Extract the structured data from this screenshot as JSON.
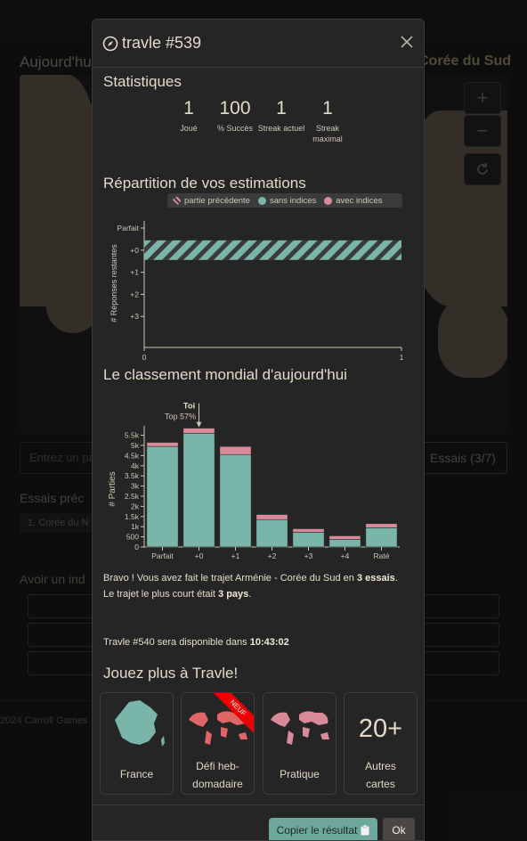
{
  "background": {
    "today_label": "Aujourd'hui",
    "target_country": "Corée du Sud",
    "zoom_in": "+",
    "zoom_out": "−",
    "input_placeholder": "Entrez un pay",
    "guess_button": "Essais (3/7)",
    "essais_title": "Essais préc",
    "essai_item": "1.  Corée du N",
    "hint_title": "Avoir un ind",
    "footer": "2024 Carroll Games"
  },
  "modal": {
    "title": "travle #539",
    "stats_title": "Statistiques",
    "stats": [
      {
        "value": "1",
        "label": "Joué"
      },
      {
        "value": "100",
        "label": "% Succès"
      },
      {
        "value": "1",
        "label": "Streak actuel"
      },
      {
        "value": "1",
        "label": "Streak maximal"
      }
    ],
    "distribution_title": "Répartition de vos estimations",
    "legend": {
      "previous": "partie précédente",
      "no_hints": "sans indices",
      "with_hints": "avec indices"
    },
    "ranking_title": "Le classement mondial d'aujourd'hui",
    "result": {
      "line1_pre": "Bravo ! Vous avez fait le trajet Arménie - Corée du Sud en ",
      "line1_bold": "3 essais",
      "line1_post": ".",
      "line2_pre": "Le trajet le plus court était ",
      "line2_bold": "3 pays",
      "line2_post": ".",
      "next_pre": "Travle #540 sera disponible dans ",
      "next_bold": "10:43:02"
    },
    "play_more_title": "Jouez plus à Travle!",
    "cards": [
      {
        "label": "France"
      },
      {
        "label": "Défi heb-\ndomadaire",
        "ribbon": "NEUF"
      },
      {
        "label": "Pratique"
      },
      {
        "label": "Autres\ncartes",
        "number": "20+"
      }
    ],
    "copy_button": "Copier le résultat",
    "ok_button": "Ok"
  },
  "colors": {
    "teal": "#79b5a9",
    "pink": "#d98a9a",
    "hatch_dark": "#3b3b3b"
  },
  "chart_data": [
    {
      "type": "bar",
      "orientation": "horizontal",
      "categories": [
        "Parfait",
        "+0",
        "+1",
        "+2",
        "+3"
      ],
      "series": [
        {
          "name": "partie précédente",
          "values": [
            0,
            1,
            0,
            0,
            0
          ]
        }
      ],
      "xlabel": "# Parties",
      "ylabel": "# Réponses restantes",
      "xlim": [
        0,
        1
      ],
      "xticks": [
        "0",
        "1"
      ],
      "grid": false
    },
    {
      "type": "bar",
      "stacked": true,
      "categories": [
        "Parfait",
        "+0",
        "+1",
        "+2",
        "+3",
        "+4",
        "Raté"
      ],
      "series": [
        {
          "name": "sans indices",
          "values": [
            4950,
            5600,
            4550,
            1350,
            730,
            380,
            950
          ]
        },
        {
          "name": "avec indices",
          "values": [
            200,
            250,
            400,
            250,
            170,
            170,
            200
          ]
        }
      ],
      "xlabel": "# Réponses restantes",
      "ylabel": "# Parties",
      "yticks": [
        "0",
        "500",
        "1k",
        "1.5k",
        "2k",
        "2.5k",
        "3k",
        "3.5k",
        "4k",
        "4.5k",
        "5k",
        "5.5k"
      ],
      "ylim": [
        0,
        5700
      ],
      "annotation": {
        "label": "Toi",
        "sublabel": "Top 57%",
        "category": "+0"
      }
    }
  ]
}
